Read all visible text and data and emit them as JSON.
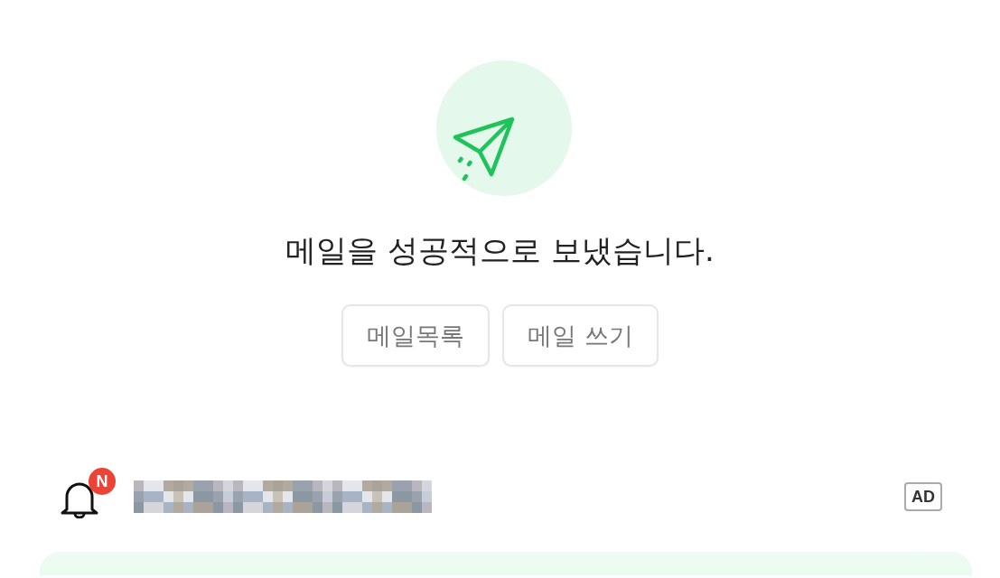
{
  "status": {
    "message": "메일을 성공적으로 보냈습니다."
  },
  "actions": [
    {
      "label": "메일목록"
    },
    {
      "label": "메일 쓰기"
    }
  ],
  "notification": {
    "badge": "N",
    "ad_label": "AD"
  }
}
